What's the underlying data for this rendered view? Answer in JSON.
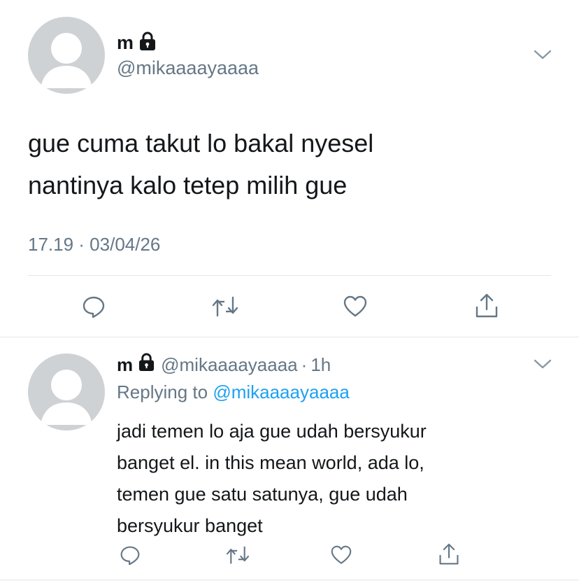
{
  "main_tweet": {
    "display_name": "m",
    "handle": "@mikaaaayaaaa",
    "text_line1": "gue cuma takut lo bakal nyesel",
    "text_line2": "nantinya kalo tetep milih gue",
    "timestamp": "17.19 · 03/04/26"
  },
  "reply": {
    "display_name": "m",
    "handle": "@mikaaaayaaaa",
    "separator": "·",
    "time": "1h",
    "replying_prefix": "Replying to",
    "replying_handle": "@mikaaaayaaaa",
    "text_line1": "jadi temen lo aja gue udah bersyukur",
    "text_line2": "banget el. in this mean world, ada lo,",
    "text_line3": "temen gue satu satunya, gue udah",
    "text_line4": "bersyukur banget"
  },
  "icons": {
    "avatar": "default-avatar-icon",
    "lock": "lock-icon",
    "chevron": "chevron-down-icon",
    "reply": "comment-icon",
    "retweet": "retweet-icon",
    "like": "heart-icon",
    "share": "share-icon"
  },
  "colors": {
    "text": "#14171a",
    "secondary": "#657786",
    "link": "#1da1f2",
    "divider": "#e1e8ed",
    "avatar_bg": "#cfd2d4"
  }
}
